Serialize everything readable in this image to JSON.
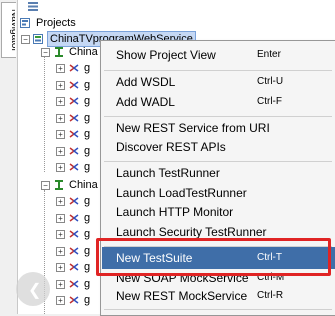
{
  "navigator": {
    "tab_label": "Navigator"
  },
  "tree": {
    "root_label": "Projects",
    "project_label": "ChinaTVprogramWebService",
    "interface1_label": "China",
    "interface2_label": "China",
    "op_prefix": "g"
  },
  "menu": {
    "items": [
      {
        "label": "Show Project View",
        "shortcut": "Enter"
      },
      {
        "label": "Add WSDL",
        "shortcut": "Ctrl-U"
      },
      {
        "label": "Add WADL",
        "shortcut": "Ctrl-F"
      },
      {
        "label": "New REST Service from URI",
        "shortcut": ""
      },
      {
        "label": "Discover REST APIs",
        "shortcut": ""
      },
      {
        "label": "Launch TestRunner",
        "shortcut": ""
      },
      {
        "label": "Launch LoadTestRunner",
        "shortcut": ""
      },
      {
        "label": "Launch HTTP Monitor",
        "shortcut": ""
      },
      {
        "label": "Launch Security TestRunner",
        "shortcut": ""
      },
      {
        "label": "New TestSuite",
        "shortcut": "Ctrl-T"
      },
      {
        "label": "New SOAP MockService",
        "shortcut": "Ctrl-M"
      },
      {
        "label": "New REST MockService",
        "shortcut": "Ctrl-R"
      }
    ]
  },
  "colors": {
    "highlight": "#3f6ea8",
    "annotation_box": "#e02424",
    "selection": "#c5d8f4"
  }
}
